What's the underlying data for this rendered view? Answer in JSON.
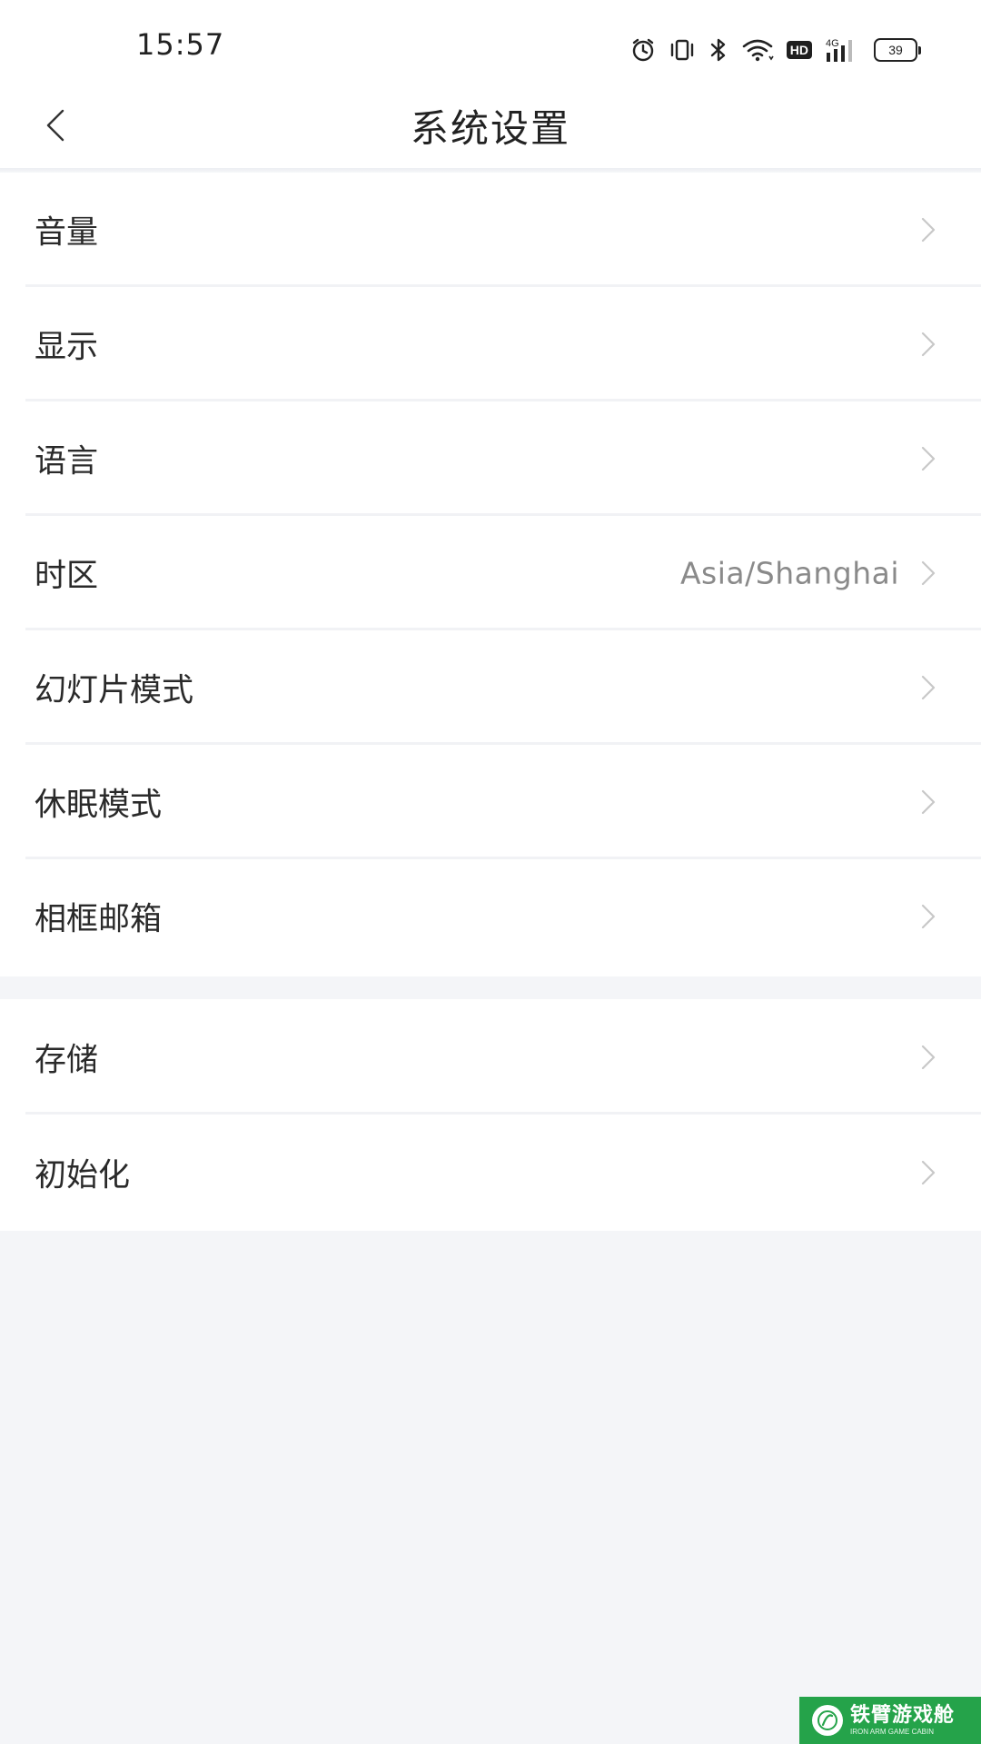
{
  "status_bar": {
    "time": "15:57",
    "icons": [
      "alarm-icon",
      "vibrate-icon",
      "bluetooth-icon",
      "wifi-icon",
      "hd-icon",
      "cellular-4g-icon",
      "battery-icon"
    ],
    "hd_label": "HD",
    "network_label": "4G",
    "battery_level": "39"
  },
  "header": {
    "back_icon": "chevron-left-icon",
    "title": "系统设置"
  },
  "groups": [
    {
      "items": [
        {
          "label": "音量",
          "value": ""
        },
        {
          "label": "显示",
          "value": ""
        },
        {
          "label": "语言",
          "value": ""
        },
        {
          "label": "时区",
          "value": "Asia/Shanghai"
        },
        {
          "label": "幻灯片模式",
          "value": ""
        },
        {
          "label": "休眠模式",
          "value": ""
        },
        {
          "label": "相框邮箱",
          "value": ""
        }
      ]
    },
    {
      "items": [
        {
          "label": "存储",
          "value": ""
        },
        {
          "label": "初始化",
          "value": ""
        }
      ]
    }
  ],
  "watermark": {
    "main": "铁臂游戏舱",
    "sub": "IRON ARM GAME CABIN"
  },
  "colors": {
    "background": "#f4f5f8",
    "card": "#ffffff",
    "text": "#2a2a2a",
    "secondary_text": "#8a8a8a",
    "chevron": "#c8c8c8",
    "watermark_green": "#25a34a"
  }
}
